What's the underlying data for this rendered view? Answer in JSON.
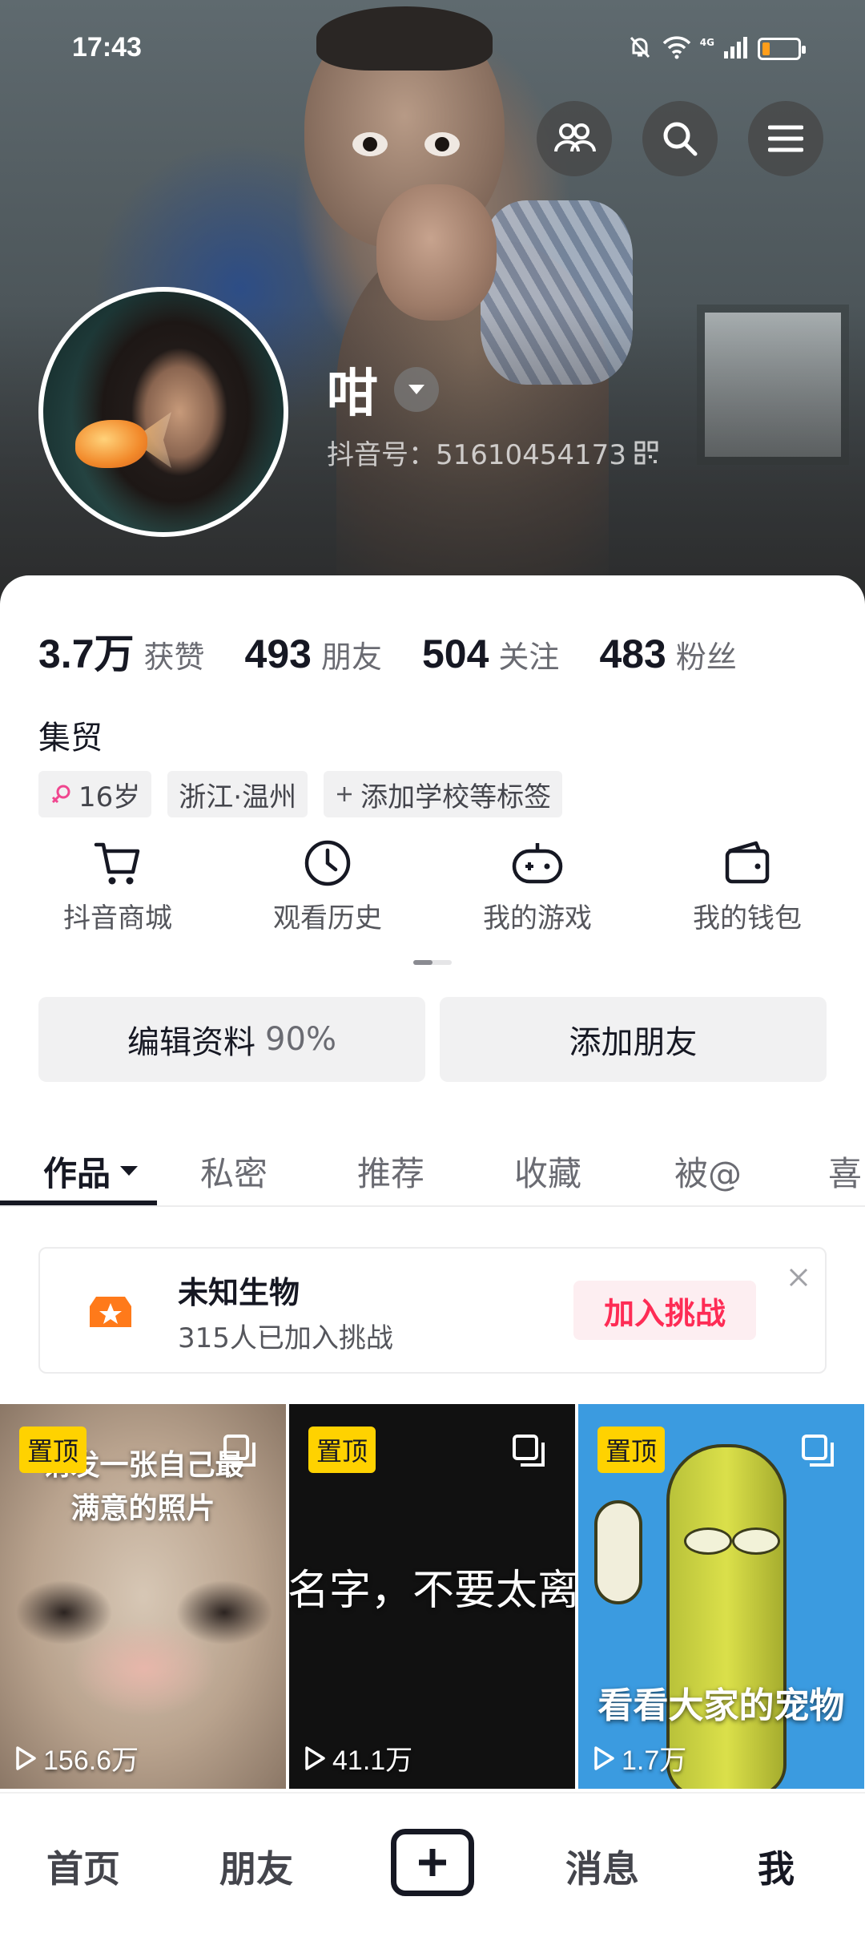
{
  "status_bar": {
    "time": "17:43",
    "network": "4G",
    "battery_level": 0.22,
    "battery_color": "#ff9e1b"
  },
  "header_icons": [
    "friends-icon",
    "search-icon",
    "menu-icon"
  ],
  "profile": {
    "name": "咁",
    "douyin_id": "抖音号：51610454173",
    "stats": [
      {
        "value": "3.7万",
        "label": "获赞"
      },
      {
        "value": "493",
        "label": "朋友"
      },
      {
        "value": "504",
        "label": "关注"
      },
      {
        "value": "483",
        "label": "粉丝"
      }
    ],
    "bio": "集贸",
    "tags": {
      "age": "16岁",
      "location": "浙江·温州",
      "add": "添加学校等标签"
    }
  },
  "quick_actions": [
    {
      "label": "抖音商城",
      "icon": "cart-icon"
    },
    {
      "label": "观看历史",
      "icon": "clock-icon"
    },
    {
      "label": "我的游戏",
      "icon": "gamepad-icon"
    },
    {
      "label": "我的钱包",
      "icon": "wallet-icon"
    }
  ],
  "buttons": {
    "edit": "编辑资料",
    "edit_pct": "90%",
    "add_friend": "添加朋友"
  },
  "tabs": [
    "作品",
    "私密",
    "推荐",
    "收藏",
    "被@",
    "喜"
  ],
  "challenge": {
    "title": "未知生物",
    "subtitle": "315人已加入挑战",
    "join": "加入挑战"
  },
  "videos": [
    {
      "pin": "置顶",
      "overlay": "请发一张自己最满意的照片",
      "plays": "156.6万"
    },
    {
      "pin": "置顶",
      "overlay": "名字，不要太离",
      "plays": "41.1万"
    },
    {
      "pin": "置顶",
      "overlay": "看看大家的宠物",
      "plays": "1.7万"
    }
  ],
  "nav": {
    "home": "首页",
    "friends": "朋友",
    "messages": "消息",
    "me": "我"
  },
  "colors": {
    "accent": "#fe2c55",
    "pin": "#ffd200",
    "text": "#161823"
  }
}
